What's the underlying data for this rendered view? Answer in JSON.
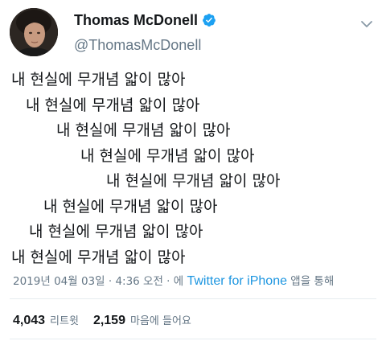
{
  "author": {
    "display_name": "Thomas McDonell",
    "handle": "@ThomasMcDonell",
    "verified": true
  },
  "tweet": {
    "lines": [
      "내 현실에 무개념 앏이 많아",
      "내 현실에 무개념 앏이 많아",
      "내 현실에 무개념 앏이 많아",
      "내 현실에 무개념 앏이 많아",
      "내 현실에 무개념 앏이 많아",
      "내 현실에 무개념 앏이 많아",
      "내 현실에 무개념 앏이 많아",
      "내 현실에 무개념 앏이 많아"
    ]
  },
  "meta": {
    "date": "2019년 04월 03일",
    "separator1": " · ",
    "time": "4:36 오전",
    "separator2": " · 에 ",
    "source": "Twitter for iPhone",
    "suffix": " 앱을 통해"
  },
  "stats": {
    "retweets_count": "4,043",
    "retweets_label": "리트윗",
    "likes_count": "2,159",
    "likes_label": "마음에 들어요"
  },
  "colors": {
    "verified_badge": "#1da1f2",
    "link": "#1b95e0",
    "secondary_text": "#657786",
    "divider": "#e6ecf0"
  },
  "icons": {
    "verified": "verified-badge-icon",
    "menu": "chevron-down-icon"
  }
}
